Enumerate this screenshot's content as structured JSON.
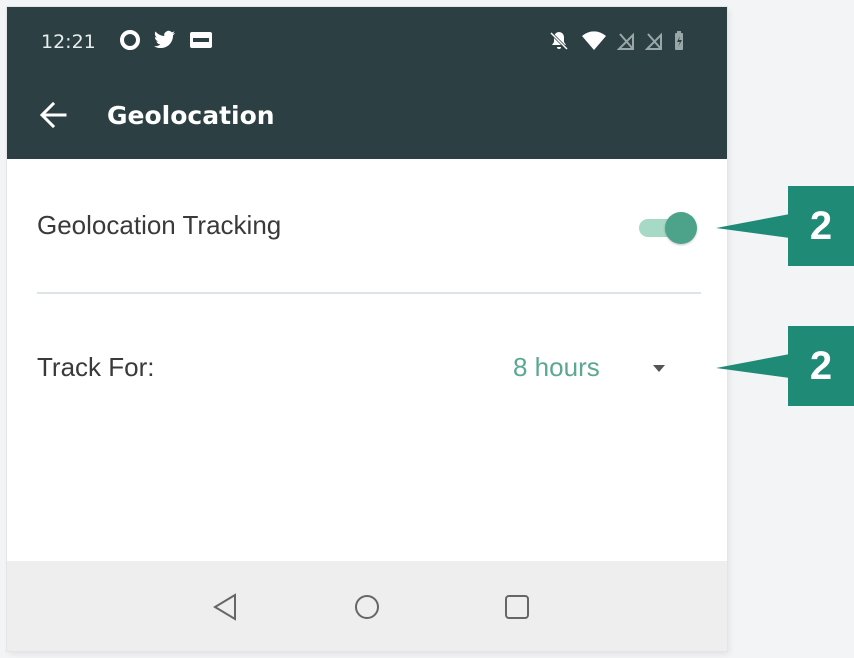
{
  "status_bar": {
    "time": "12:21",
    "left_icons": [
      "circle-notification-icon",
      "twitter-icon",
      "imdb-icon"
    ],
    "right_icons": [
      "bell-off-icon",
      "wifi-icon",
      "signal-off-icon",
      "signal-off-icon",
      "battery-charging-icon"
    ]
  },
  "app_bar": {
    "title": "Geolocation",
    "back_icon": "arrow-left-icon"
  },
  "settings": {
    "tracking_label": "Geolocation Tracking",
    "tracking_enabled": true,
    "track_for_label": "Track For:",
    "track_for_value": "8 hours"
  },
  "nav_bar": {
    "buttons": [
      "back-triangle-icon",
      "home-circle-icon",
      "recents-square-icon"
    ]
  },
  "callouts": [
    {
      "label": "2"
    },
    {
      "label": "2"
    }
  ],
  "colors": {
    "app_bar": "#2c4043",
    "accent": "#4da28a",
    "accent_light": "#a6d9c6",
    "callout": "#1f8a76",
    "dropdown_text": "#5aa890"
  }
}
